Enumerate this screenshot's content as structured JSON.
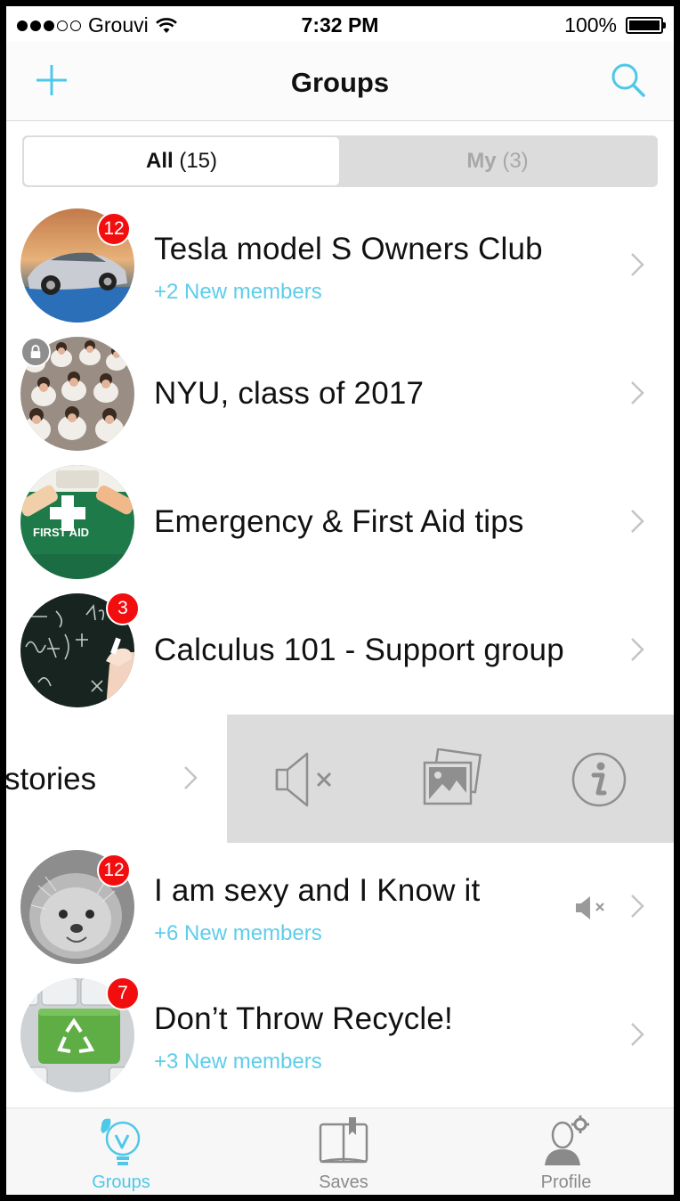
{
  "status_bar": {
    "carrier": "Grouvi",
    "time": "7:32 PM",
    "battery": "100%"
  },
  "nav": {
    "title": "Groups",
    "add_icon": "plus-icon",
    "search_icon": "search-icon"
  },
  "segment": {
    "all_label": "All",
    "all_count": "(15)",
    "my_label": "My",
    "my_count": "(3)",
    "selected": "All"
  },
  "groups": [
    {
      "title": "Tesla model S Owners Club",
      "subtitle": "+2 New members",
      "badge": "12",
      "image": "tesla-car-avatar"
    },
    {
      "title": "NYU, class of 2017",
      "subtitle": "",
      "badge": "",
      "locked": true,
      "image": "graduates-avatar"
    },
    {
      "title": "Emergency & First Aid tips",
      "subtitle": "",
      "badge": "",
      "image": "first-aid-kit-avatar"
    },
    {
      "title": "Calculus 101 - Support group",
      "subtitle": "",
      "badge": "3",
      "image": "chalkboard-avatar"
    },
    {
      "title": "stories",
      "subtitle": "",
      "badge": "",
      "swiped": true,
      "actions": [
        "mute-icon",
        "photos-icon",
        "info-icon"
      ]
    },
    {
      "title": "I am sexy and I Know it",
      "subtitle": "+6 New members",
      "badge": "12",
      "muted": true,
      "image": "hedgehog-avatar"
    },
    {
      "title": "Don’t Throw Recycle!",
      "subtitle": "+3 New members",
      "badge": "7",
      "image": "recycle-key-avatar"
    }
  ],
  "tabs": [
    {
      "label": "Groups",
      "icon": "groups-bulb-icon",
      "active": true
    },
    {
      "label": "Saves",
      "icon": "saves-book-icon",
      "active": false
    },
    {
      "label": "Profile",
      "icon": "profile-gear-icon",
      "active": false
    }
  ],
  "colors": {
    "accent": "#4dc8e8",
    "badge": "#f20e0e",
    "subtitle": "#5dcdea",
    "swipe_bg": "#dcdcdc",
    "inactive_tab": "#8a8a8a"
  }
}
